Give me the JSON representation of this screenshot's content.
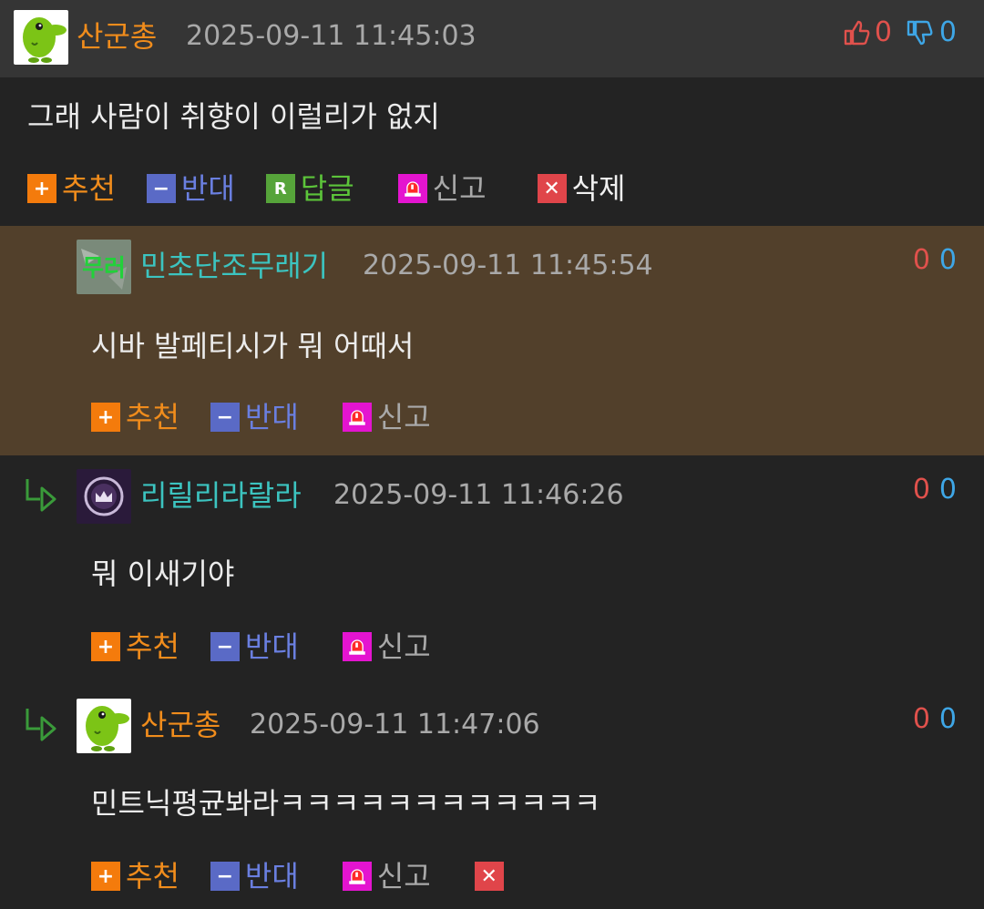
{
  "comments": [
    {
      "nick": "산군총",
      "time": "2025-09-11 11:45:03",
      "upvotes": "0",
      "downvotes": "0",
      "text": "그래 사람이 취향이 이럴리가 없지",
      "actions": {
        "recommend": "추천",
        "oppose": "반대",
        "reply": "답글",
        "reply_badge": "R",
        "report": "신고",
        "delete": "삭제"
      }
    },
    {
      "nick": "민초단조무래기",
      "avatar_text": "무러",
      "time": "2025-09-11 11:45:54",
      "upvotes": "0",
      "downvotes": "0",
      "text": "시바 발페티시가 뭐 어때서",
      "actions": {
        "recommend": "추천",
        "oppose": "반대",
        "report": "신고"
      }
    },
    {
      "nick": "리릴리라랄라",
      "time": "2025-09-11 11:46:26",
      "upvotes": "0",
      "downvotes": "0",
      "text": "뭐 이새기야",
      "actions": {
        "recommend": "추천",
        "oppose": "반대",
        "report": "신고"
      }
    },
    {
      "nick": "산군총",
      "time": "2025-09-11 11:47:06",
      "upvotes": "0",
      "downvotes": "0",
      "text": "민트닉평균봐라ㅋㅋㅋㅋㅋㅋㅋㅋㅋㅋㅋㅋ",
      "actions": {
        "recommend": "추천",
        "oppose": "반대",
        "report": "신고"
      }
    }
  ],
  "icons": {
    "plus": "plus-icon",
    "minus": "minus-icon",
    "reply": "reply-icon",
    "report": "siren-icon",
    "delete": "close-icon",
    "thumbs_up": "thumbs-up-icon",
    "thumbs_down": "thumbs-down-icon",
    "reply_arrow": "reply-arrow-icon"
  },
  "colors": {
    "background": "#232323",
    "header_bar": "#353535",
    "highlight_row": "#52402b",
    "nick_orange": "#f08c1c",
    "nick_teal": "#3cc4c0",
    "upvote_red": "#e0514c",
    "downvote_blue": "#3ea6e6"
  }
}
